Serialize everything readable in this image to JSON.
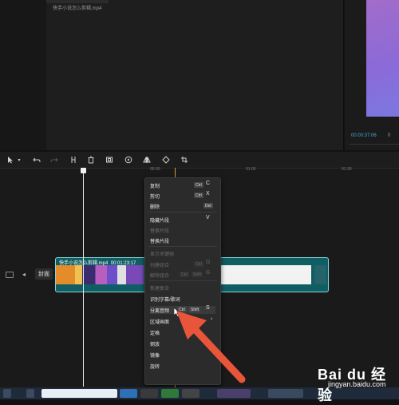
{
  "media": {
    "caption": "快手小说怎么剪辑.mp4"
  },
  "preview": {
    "current_time": "00:00:37:06",
    "end_time": "0"
  },
  "toolbar": {
    "icons": [
      "select-icon",
      "undo-icon",
      "redo-icon",
      "split-icon",
      "delete-icon",
      "freeze-icon",
      "playback-icon",
      "mirror-icon",
      "rotate-icon",
      "crop-icon"
    ]
  },
  "ruler": {
    "labels": [
      "00:30",
      "01:00",
      "01:30"
    ]
  },
  "track": {
    "cover_label": "封面"
  },
  "clip": {
    "title": "快手小说怎么剪辑.mp4",
    "duration": "00:01:23:17"
  },
  "context_menu": {
    "items": [
      {
        "label": "复制",
        "key": "Ctrl",
        "shortcut": "C",
        "disabled": false
      },
      {
        "label": "剪切",
        "key": "Ctrl",
        "shortcut": "X",
        "disabled": false
      },
      {
        "label": "删除",
        "key": "Del",
        "shortcut": "",
        "disabled": false
      },
      {
        "label": "隐藏片段",
        "key": "",
        "shortcut": "V",
        "disabled": false
      },
      {
        "label": "替换片段",
        "key": "",
        "shortcut": "",
        "disabled": true
      },
      {
        "label": "替换片段",
        "key": "",
        "shortcut": "",
        "disabled": false
      },
      {
        "label": "显示关键帧",
        "key": "",
        "shortcut": "",
        "disabled": true
      },
      {
        "label": "创建组合",
        "key": "Ctrl",
        "shortcut": "G",
        "disabled": true
      },
      {
        "label": "解除组合",
        "key": "Ctrl",
        "key2": "Shift",
        "shortcut": "G",
        "disabled": true
      },
      {
        "label": "新建复合",
        "key": "",
        "shortcut": "",
        "disabled": true
      },
      {
        "label": "识别字幕/歌词",
        "key": "",
        "shortcut": "",
        "disabled": false
      },
      {
        "label": "分离音频",
        "key": "Ctrl",
        "key2": "Shift",
        "shortcut": "S",
        "disabled": false
      },
      {
        "label": "区域画面",
        "key": "",
        "shortcut": "›",
        "disabled": false
      },
      {
        "label": "定格",
        "key": "",
        "shortcut": "",
        "disabled": false
      },
      {
        "label": "倒放",
        "key": "",
        "shortcut": "",
        "disabled": false
      },
      {
        "label": "镜像",
        "key": "",
        "shortcut": "",
        "disabled": false
      },
      {
        "label": "旋转",
        "key": "",
        "shortcut": "",
        "disabled": false
      }
    ]
  },
  "watermark": {
    "brand": "Bai du 经验",
    "url": "jingyan.baidu.com"
  },
  "colors": {
    "accent": "#d79a3a",
    "clip": "#0e5e63",
    "arrow": "#e8553a",
    "timecode": "#4aa6d8"
  }
}
